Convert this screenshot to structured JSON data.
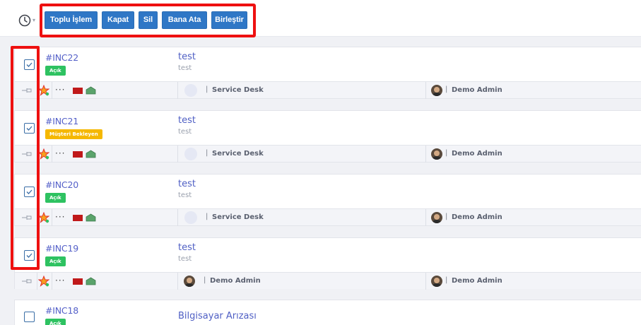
{
  "toolbar": {
    "icon": "clock-icon",
    "buttons": [
      "Toplu İşlem",
      "Kapat",
      "Sil",
      "Bana Ata",
      "Birleştir"
    ]
  },
  "tickets": [
    {
      "id": "#INC22",
      "status": "Açık",
      "status_color": "#2ec261",
      "subject": "test",
      "description": "test",
      "checked": true,
      "group": "Service Desk",
      "assignee": "Demo Admin"
    },
    {
      "id": "#INC21",
      "status": "Müşteri Bekleyen",
      "status_color": "#f5b800",
      "subject": "test",
      "description": "test",
      "checked": true,
      "group": "Service Desk",
      "assignee": "Demo Admin"
    },
    {
      "id": "#INC20",
      "status": "Açık",
      "status_color": "#2ec261",
      "subject": "test",
      "description": "test",
      "checked": true,
      "group": "Service Desk",
      "assignee": "Demo Admin"
    },
    {
      "id": "#INC19",
      "status": "Açık",
      "status_color": "#2ec261",
      "subject": "test",
      "description": "test",
      "checked": true,
      "group": "Demo Admin",
      "assignee": "Demo Admin"
    },
    {
      "id": "#INC18",
      "status": "Açık",
      "status_color": "#2ec261",
      "subject": "Bilgisayar Arızası",
      "description": "",
      "checked": false
    }
  ],
  "colors": {
    "accent": "#2f77c6",
    "highlight": "#ee1010",
    "flag": "#c0191a"
  }
}
